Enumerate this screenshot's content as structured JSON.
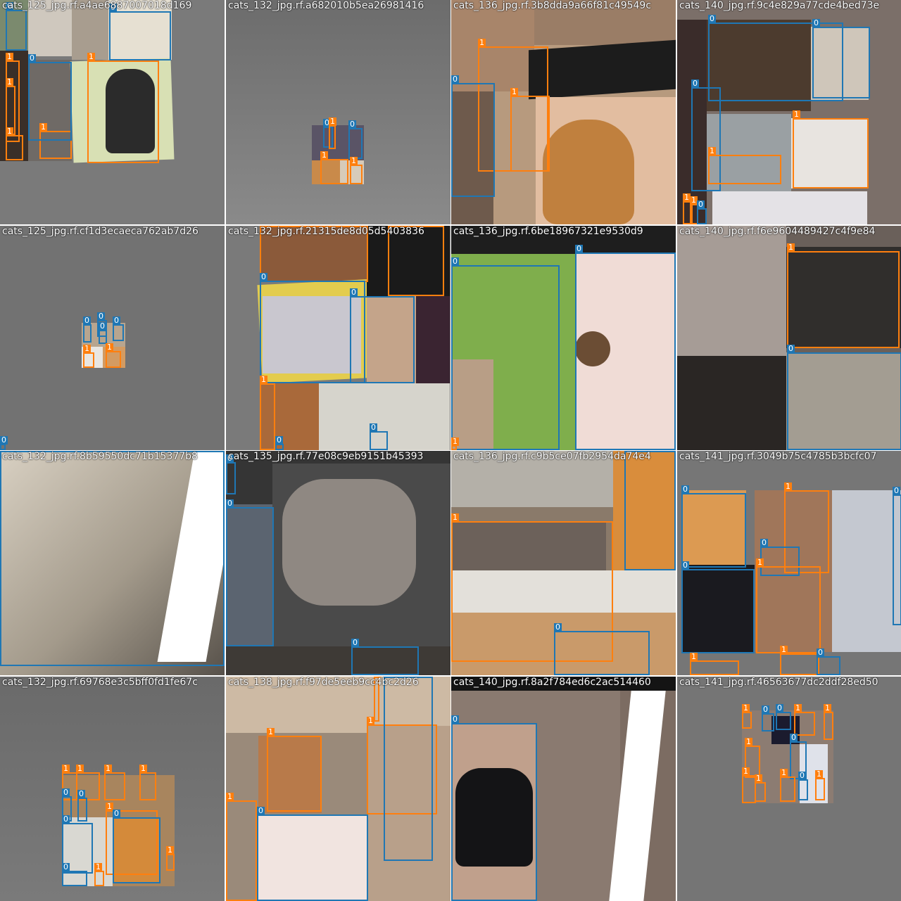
{
  "colors": {
    "class_0": "#1f77b4",
    "class_1": "#ff7f0e",
    "grid_line": "#ffffff",
    "padding_grey": "#727272"
  },
  "tiles": [
    {
      "title": "cats_125_jpg.rf.a4ae6887007018d169",
      "boxes": [
        {
          "label": "0"
        },
        {
          "label": "0"
        },
        {
          "label": "1"
        },
        {
          "label": "1"
        },
        {
          "label": "1"
        },
        {
          "label": "1"
        },
        {
          "label": "0"
        },
        {
          "label": "1"
        }
      ]
    },
    {
      "title": "cats_132_jpg.rf.a682010b5ea26981416",
      "boxes": [
        {
          "label": "0"
        },
        {
          "label": "1"
        },
        {
          "label": "0"
        },
        {
          "label": "1"
        },
        {
          "label": "1"
        }
      ]
    },
    {
      "title": "cats_136_jpg.rf.3b8dda9a66f81c49549c",
      "boxes": [
        {
          "label": "1"
        },
        {
          "label": "0"
        },
        {
          "label": "1"
        }
      ]
    },
    {
      "title": "cats_140_jpg.rf.9c4e829a77cde4bed73e",
      "boxes": [
        {
          "label": "0"
        },
        {
          "label": "0"
        },
        {
          "label": "0"
        },
        {
          "label": "1"
        },
        {
          "label": "1"
        },
        {
          "label": "1"
        },
        {
          "label": "1"
        },
        {
          "label": "0"
        }
      ]
    },
    {
      "title": "cats_125_jpg.rf.cf1d3ecaeca762ab7d26",
      "boxes": [
        {
          "label": "0"
        },
        {
          "label": "0"
        },
        {
          "label": "0"
        },
        {
          "label": "0"
        },
        {
          "label": "1"
        },
        {
          "label": "1"
        },
        {
          "label": "0"
        }
      ]
    },
    {
      "title": "cats_132_jpg.rf.21315de8d05d5403836",
      "boxes": [
        {
          "label": "1"
        },
        {
          "label": "0"
        },
        {
          "label": "0"
        },
        {
          "label": "1"
        },
        {
          "label": "1"
        },
        {
          "label": "0"
        },
        {
          "label": "0"
        }
      ]
    },
    {
      "title": "cats_136_jpg.rf.6be18967321e9530d9",
      "boxes": [
        {
          "label": "0"
        },
        {
          "label": "0"
        },
        {
          "label": "1"
        }
      ]
    },
    {
      "title": "cats_140_jpg.rf.f6e9604489427c4f9e84",
      "boxes": [
        {
          "label": "1"
        },
        {
          "label": "0"
        }
      ]
    },
    {
      "title": "cats_132_jpg.rf.8b59550dc71b15377b8",
      "boxes": [
        {
          "label": "0"
        }
      ]
    },
    {
      "title": "cats_135_jpg.rf.77e08c9eb9151b45393",
      "boxes": [
        {
          "label": "0"
        },
        {
          "label": "0"
        },
        {
          "label": "0"
        }
      ]
    },
    {
      "title": "cats_136_jpg.rf.c9b5ce07fb2954da74e4",
      "boxes": [
        {
          "label": "1"
        },
        {
          "label": "0"
        },
        {
          "label": "0"
        }
      ]
    },
    {
      "title": "cats_141_jpg.rf.3049b75c4785b3bcfc07",
      "boxes": [
        {
          "label": "1"
        },
        {
          "label": "0"
        },
        {
          "label": "0"
        },
        {
          "label": "1"
        },
        {
          "label": "0"
        },
        {
          "label": "0"
        },
        {
          "label": "1"
        },
        {
          "label": "1"
        },
        {
          "label": "0"
        }
      ]
    },
    {
      "title": "cats_132_jpg.rf.69768e3c5bff0fd1fe67c",
      "boxes": [
        {
          "label": "1"
        },
        {
          "label": "1"
        },
        {
          "label": "1"
        },
        {
          "label": "1"
        },
        {
          "label": "0"
        },
        {
          "label": "0"
        },
        {
          "label": "0"
        },
        {
          "label": "1"
        },
        {
          "label": "0"
        },
        {
          "label": "1"
        },
        {
          "label": "1"
        },
        {
          "label": "0"
        }
      ]
    },
    {
      "title": "cats_138_jpg.rf.f97de5eeb9cc4bc2d26",
      "boxes": [
        {
          "label": "1"
        },
        {
          "label": "1"
        },
        {
          "label": "1"
        },
        {
          "label": "1"
        },
        {
          "label": "0"
        },
        {
          "label": "0"
        }
      ]
    },
    {
      "title": "cats_140_jpg.rf.8a2f784ed6c2ac514460",
      "boxes": [
        {
          "label": "0"
        }
      ]
    },
    {
      "title": "cats_141_jpg.rf.46563677dc2ddf28ed50",
      "boxes": [
        {
          "label": "1"
        },
        {
          "label": "0"
        },
        {
          "label": "0"
        },
        {
          "label": "1"
        },
        {
          "label": "1"
        },
        {
          "label": "1"
        },
        {
          "label": "0"
        },
        {
          "label": "1"
        },
        {
          "label": "1"
        },
        {
          "label": "0"
        },
        {
          "label": "1"
        },
        {
          "label": "1"
        }
      ]
    }
  ]
}
